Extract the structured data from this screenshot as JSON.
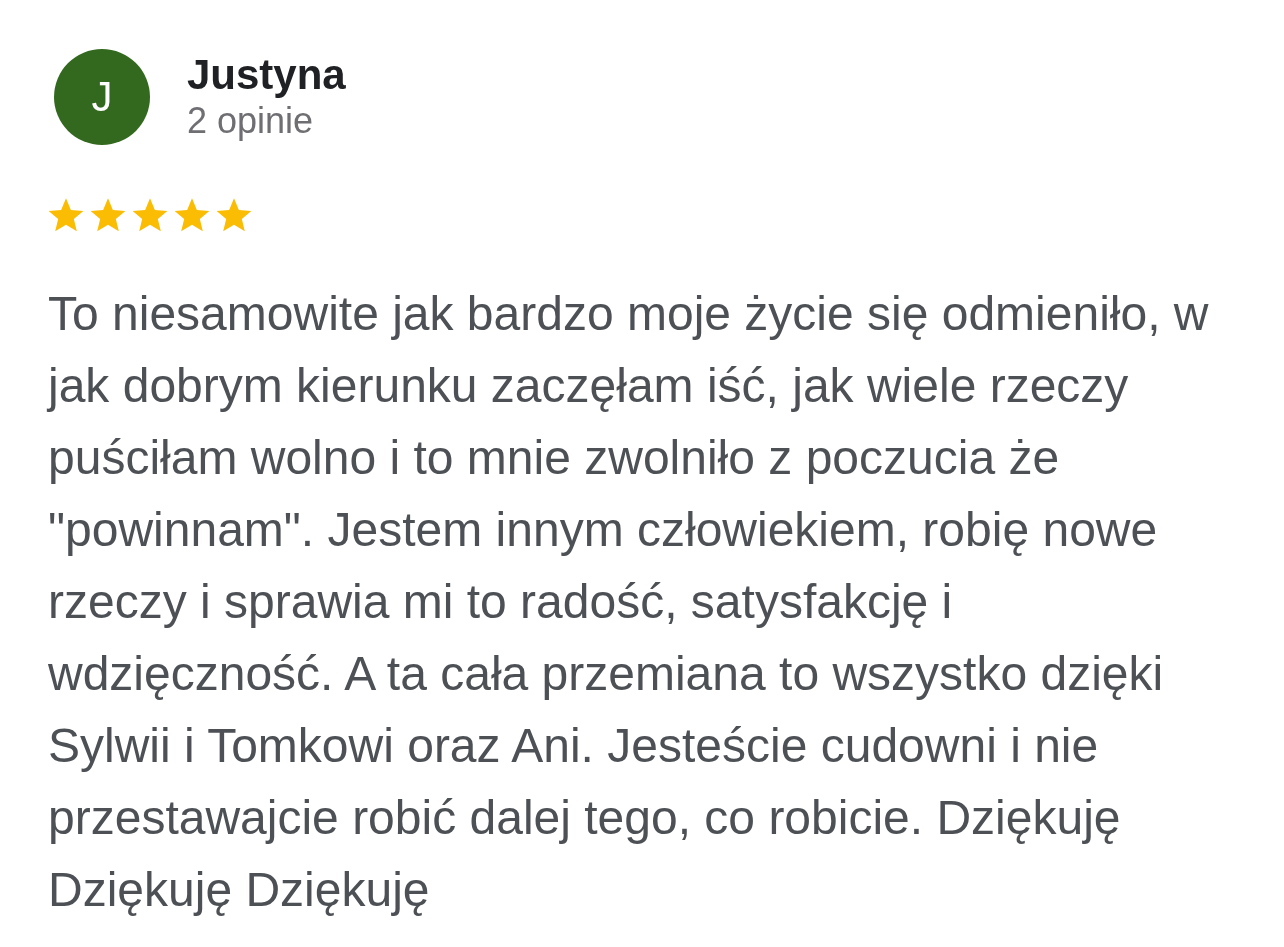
{
  "reviewer": {
    "initial": "J",
    "name": "Justyna",
    "review_count": "2 opinie"
  },
  "rating": {
    "stars": 5
  },
  "review": {
    "text": "To niesamowite jak bardzo moje życie się odmieniło, w jak dobrym kierunku zaczęłam iść, jak wiele rzeczy puściłam wolno i to mnie zwolniło z poczucia że \"powinnam\". Jestem innym człowiekiem, robię nowe rzeczy i sprawia mi to radość, satysfakcję i wdzięczność. A ta cała przemiana to wszystko dzięki Sylwii i Tomkowi oraz Ani. Jesteście cudowni i nie przestawajcie robić dalej tego, co robicie. Dziękuję Dziękuję Dziękuję"
  }
}
